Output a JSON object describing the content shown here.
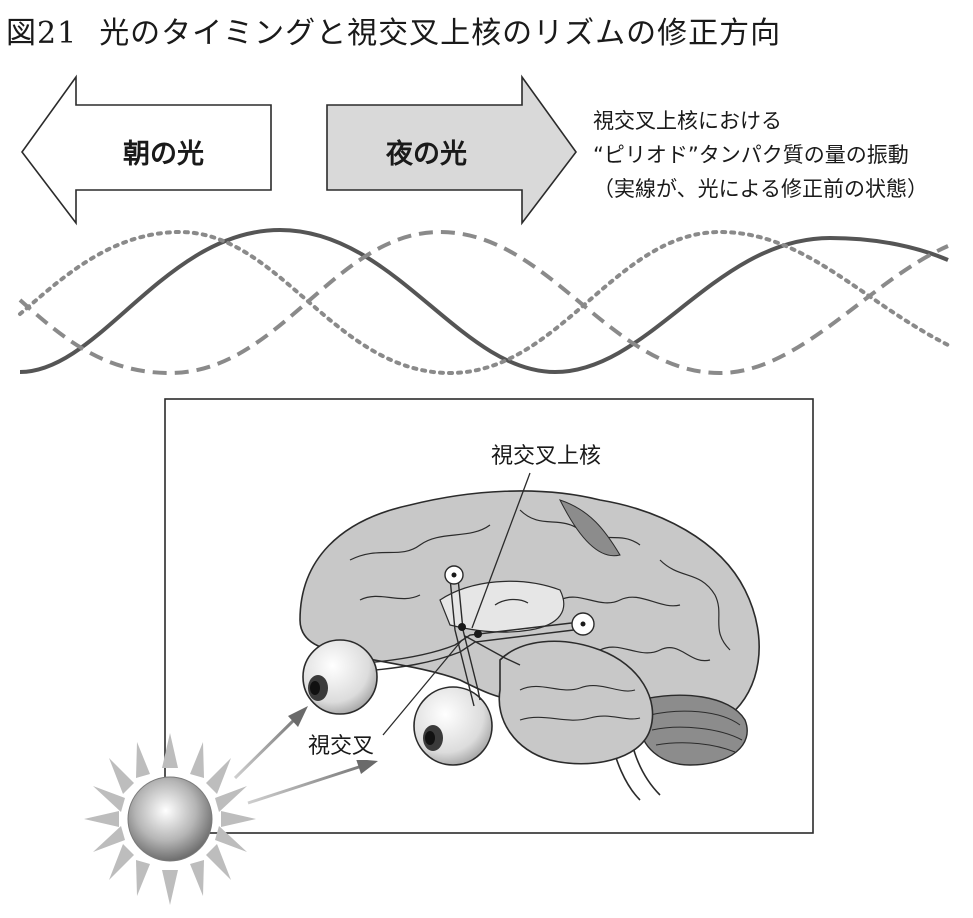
{
  "figure": {
    "number": "図21",
    "title": "光のタイミングと視交叉上核のリズムの修正方向"
  },
  "arrows": {
    "morning": {
      "label": "朝の光",
      "direction": "left",
      "fill": "#ffffff"
    },
    "night": {
      "label": "夜の光",
      "direction": "right",
      "fill": "#d9d9d9"
    }
  },
  "caption": {
    "line1": "視交叉上核における",
    "line2": "“ピリオド”タンパク質の量の振動",
    "line3": "（実線が、光による修正前の状態）"
  },
  "waves": [
    {
      "style": "solid",
      "color": "#555555"
    },
    {
      "style": "dotted",
      "color": "#8a8a8a"
    },
    {
      "style": "dashed",
      "color": "#8a8a8a"
    }
  ],
  "labels": {
    "scn": "視交叉上核",
    "chiasm": "視交叉"
  },
  "colors": {
    "brain": "#c8c8c8",
    "brain_dark": "#8c8c8c",
    "outline": "#2b2b2b"
  }
}
